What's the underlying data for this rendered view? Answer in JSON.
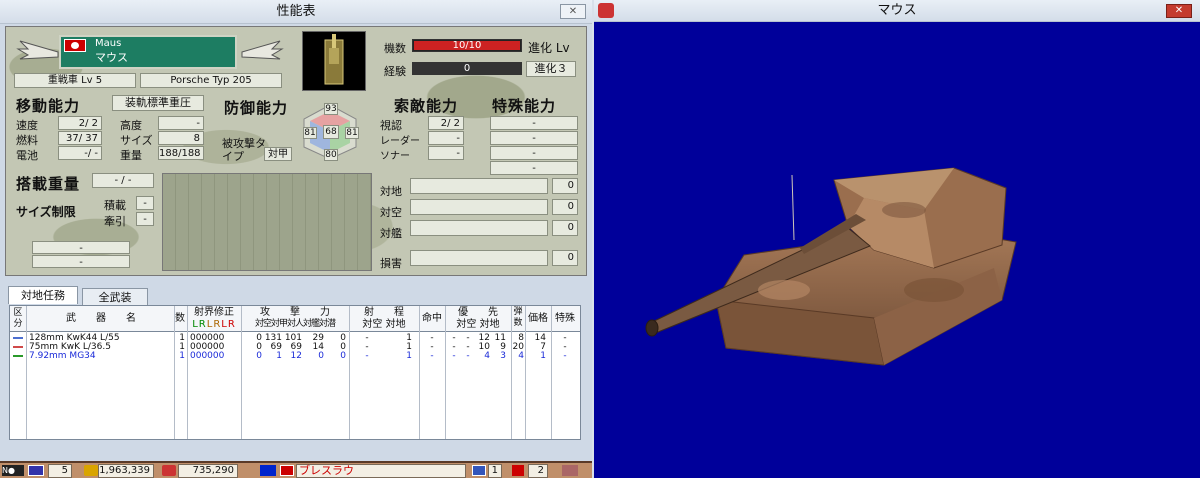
{
  "left_window": {
    "title": "性能表",
    "close_glyph": "✕"
  },
  "unit": {
    "name_en": "Maus",
    "name_jp": "マウス",
    "class_level": "重戦車 Lv 5",
    "model": "Porsche Typ 205",
    "count_label": "機数",
    "count_value": "10/10",
    "count_fraction": 1.0,
    "exp_label": "経験",
    "exp_value": "0",
    "exp_fraction": 0.0,
    "evolution_label": "進化 Lv",
    "evolution_value": "進化３"
  },
  "mobility": {
    "heading": "移動能力",
    "move_type": "装軌標準重圧",
    "speed_label": "速度",
    "speed_value": "2/ 2",
    "fuel_label": "燃料",
    "fuel_value": "37/ 37",
    "battery_label": "電池",
    "battery_value": "-/ -",
    "altitude_label": "高度",
    "altitude_value": "-",
    "size_label": "サイズ",
    "size_value": "8",
    "weight_label": "重量",
    "weight_value": "188/188"
  },
  "defense": {
    "heading": "防御能力",
    "armor_top": "93",
    "armor_left": "81",
    "armor_center": "68",
    "armor_right": "81",
    "armor_bottom": "80",
    "target_label": "被攻撃タイプ",
    "target_value": "対甲"
  },
  "search": {
    "heading": "索敵能力",
    "sight_label": "視認",
    "sight_value": "2/ 2",
    "radar_label": "レーダー",
    "radar_value": "-",
    "sonar_label": "ソナー",
    "sonar_value": "-"
  },
  "special": {
    "heading": "特殊能力",
    "values": [
      "-",
      "-",
      "-",
      "-"
    ]
  },
  "loadout": {
    "capacity_label": "搭載重量",
    "capacity_value": "- / -",
    "size_limit_label": "サイズ制限",
    "load_label": "積載",
    "load_value": "-",
    "tow_label": "牽引",
    "tow_value": "-",
    "extra": [
      "-",
      "-"
    ]
  },
  "attack_summary": [
    {
      "label": "対地",
      "value": "0"
    },
    {
      "label": "対空",
      "value": "0"
    },
    {
      "label": "対艦",
      "value": "0"
    },
    {
      "label": "損害",
      "value": "0"
    }
  ],
  "tabs": [
    {
      "label": "対地任務"
    },
    {
      "label": "全武装"
    }
  ],
  "table": {
    "headers": {
      "kubun": "区分",
      "weapon": "武　　器　　名",
      "count": "数",
      "sight": "射界修正",
      "lr": [
        "L",
        "R",
        "L",
        "R",
        "L",
        "R"
      ],
      "attack": "攻　　撃　　力",
      "attack_sub": [
        "対空",
        "対甲",
        "対人",
        "対艦",
        "対潜"
      ],
      "range": "射　　程",
      "range_sub": [
        "対空",
        "対地"
      ],
      "hit": "命中",
      "priority": "優　　先",
      "priority_sub": [
        "対空",
        "対地"
      ],
      "ammo": "弾数",
      "price": "価格",
      "special": "特殊"
    },
    "rows": [
      {
        "name": "128mm KwK44 L/55",
        "count": "1",
        "lr": "000000",
        "atk": [
          "0",
          "131",
          "101",
          "29",
          "0"
        ],
        "rng": [
          "-",
          "1"
        ],
        "hit": "-",
        "pri": [
          "-",
          "-",
          "12",
          "11"
        ],
        "ammo": "8",
        "price": "14",
        "special": "-",
        "color": "#111111"
      },
      {
        "name": "75mm KwK L/36.5",
        "count": "1",
        "lr": "000000",
        "atk": [
          "0",
          "69",
          "69",
          "14",
          "0"
        ],
        "rng": [
          "-",
          "1"
        ],
        "hit": "-",
        "pri": [
          "-",
          "-",
          "10",
          "9"
        ],
        "ammo": "20",
        "price": "7",
        "special": "-",
        "color": "#111111"
      },
      {
        "name": "7.92mm MG34",
        "count": "1",
        "lr": "000000",
        "atk": [
          "0",
          "1",
          "12",
          "0",
          "0"
        ],
        "rng": [
          "-",
          "1"
        ],
        "hit": "-",
        "pri": [
          "-",
          "-",
          "4",
          "3"
        ],
        "ammo": "4",
        "price": "1",
        "special": "-",
        "color": "#1a2ad8"
      }
    ]
  },
  "status_bar": {
    "turn": "5",
    "funds": "1,963,339",
    "income": "735,290",
    "location": "ブレスラウ",
    "count_a": "1",
    "count_b": "2"
  },
  "right_window": {
    "title": "マウス",
    "close_glyph": "✕"
  }
}
